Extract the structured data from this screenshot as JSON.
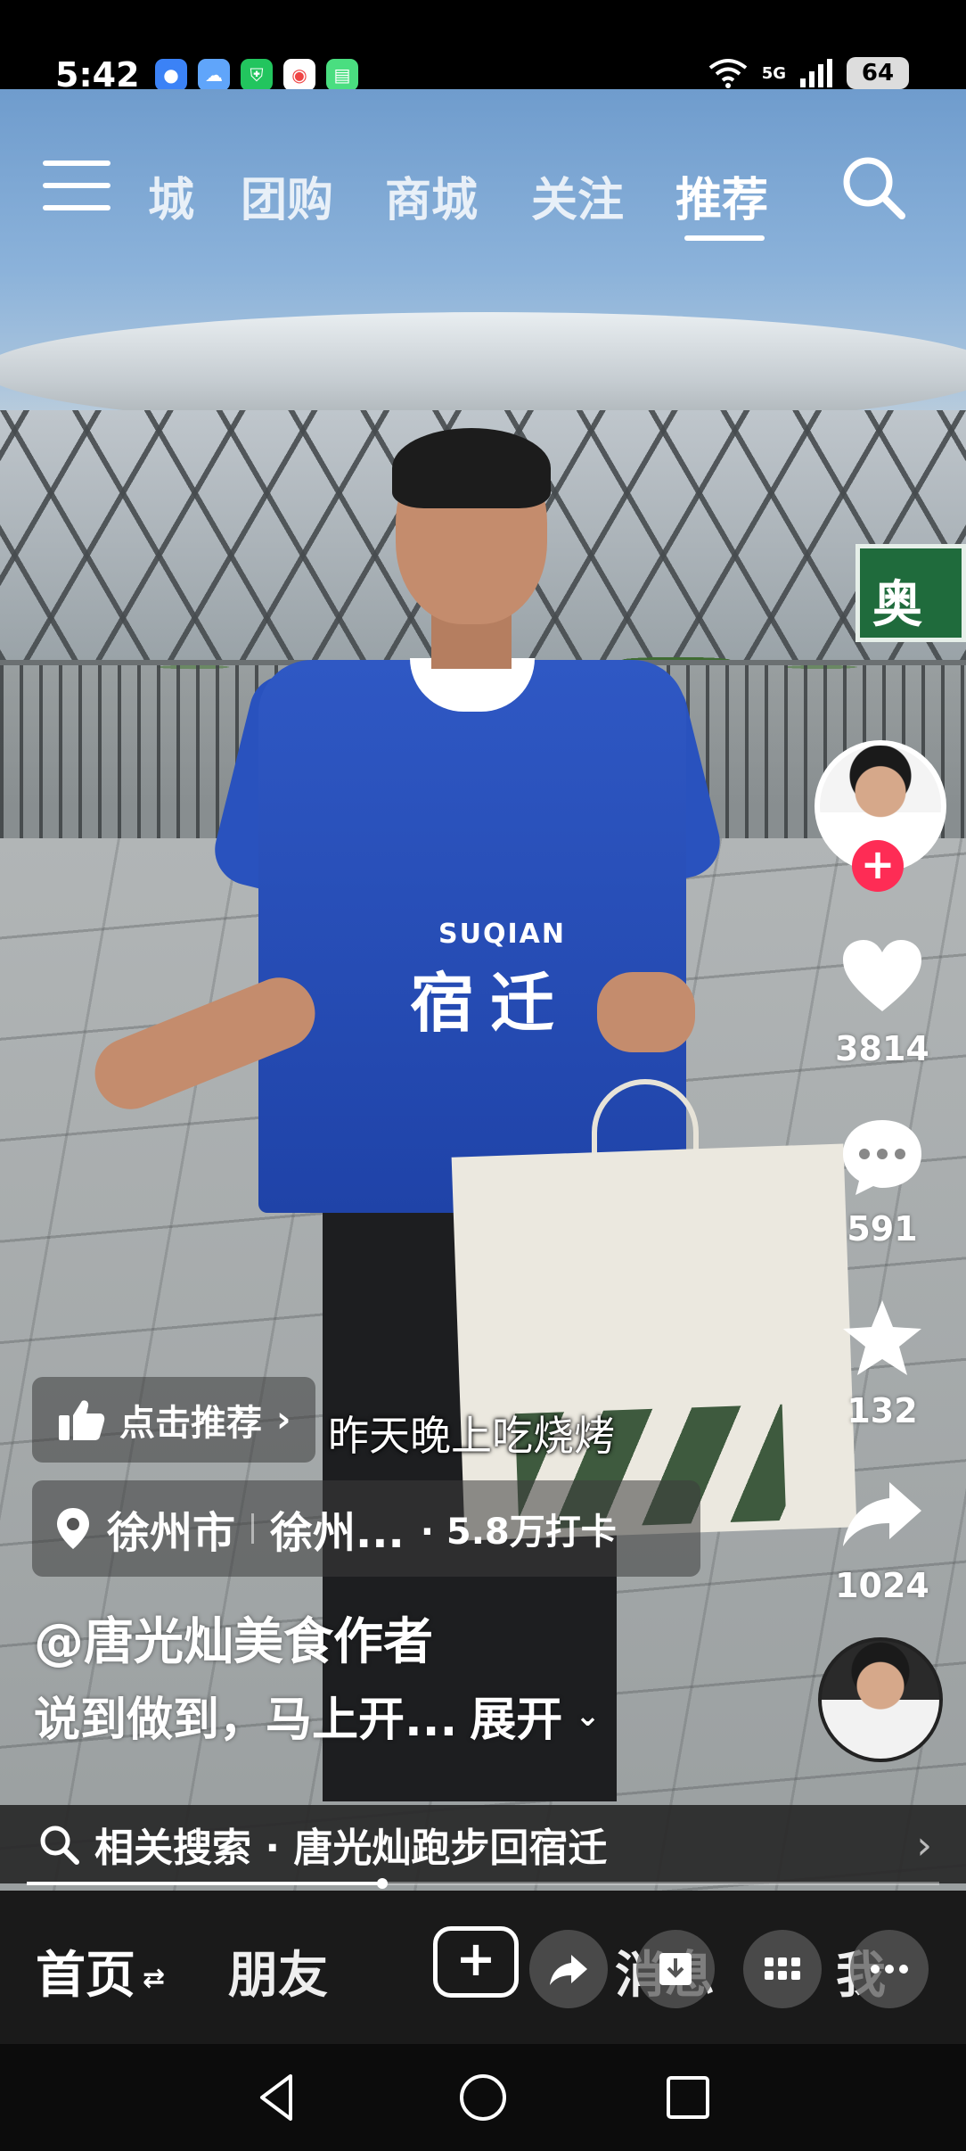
{
  "status_bar": {
    "time": "5:42",
    "apps": [
      {
        "icon": "browser-icon",
        "color": "#3b82f6"
      },
      {
        "icon": "weather-icon",
        "color": "#60a5fa"
      },
      {
        "icon": "shield-icon",
        "color": "#22c55e"
      },
      {
        "icon": "assistant-icon",
        "color": "#ef4444"
      },
      {
        "icon": "message-icon",
        "color": "#4ade80"
      }
    ],
    "network": "5G",
    "battery": "64"
  },
  "top_tabs": {
    "items": [
      "城",
      "团购",
      "商城",
      "关注",
      "推荐"
    ],
    "active": "推荐"
  },
  "video": {
    "jersey_en": "SUQIAN",
    "jersey_zh": "宿迁",
    "sign_text": "奥",
    "subtitle": "昨天晚上吃烧烤"
  },
  "right_rail": {
    "like_count": "3814",
    "comment_count": "591",
    "favorite_count": "132",
    "share_count": "1024",
    "accent": "#fe2c55"
  },
  "overlay": {
    "recommend_label": "点击推荐",
    "location_city": "徐州市",
    "location_place": "徐州...",
    "location_checkin": "· 5.8万打卡",
    "author": "@唐光灿美食作者",
    "description": "说到做到，马上开...",
    "expand_label": "展开"
  },
  "related_search": {
    "text": "相关搜索 · 唐光灿跑步回宿迁"
  },
  "progress": {
    "fraction": 0.39
  },
  "bottom_nav": {
    "home": "首页",
    "friends": "朋友",
    "messages": "消息",
    "me": "我"
  }
}
